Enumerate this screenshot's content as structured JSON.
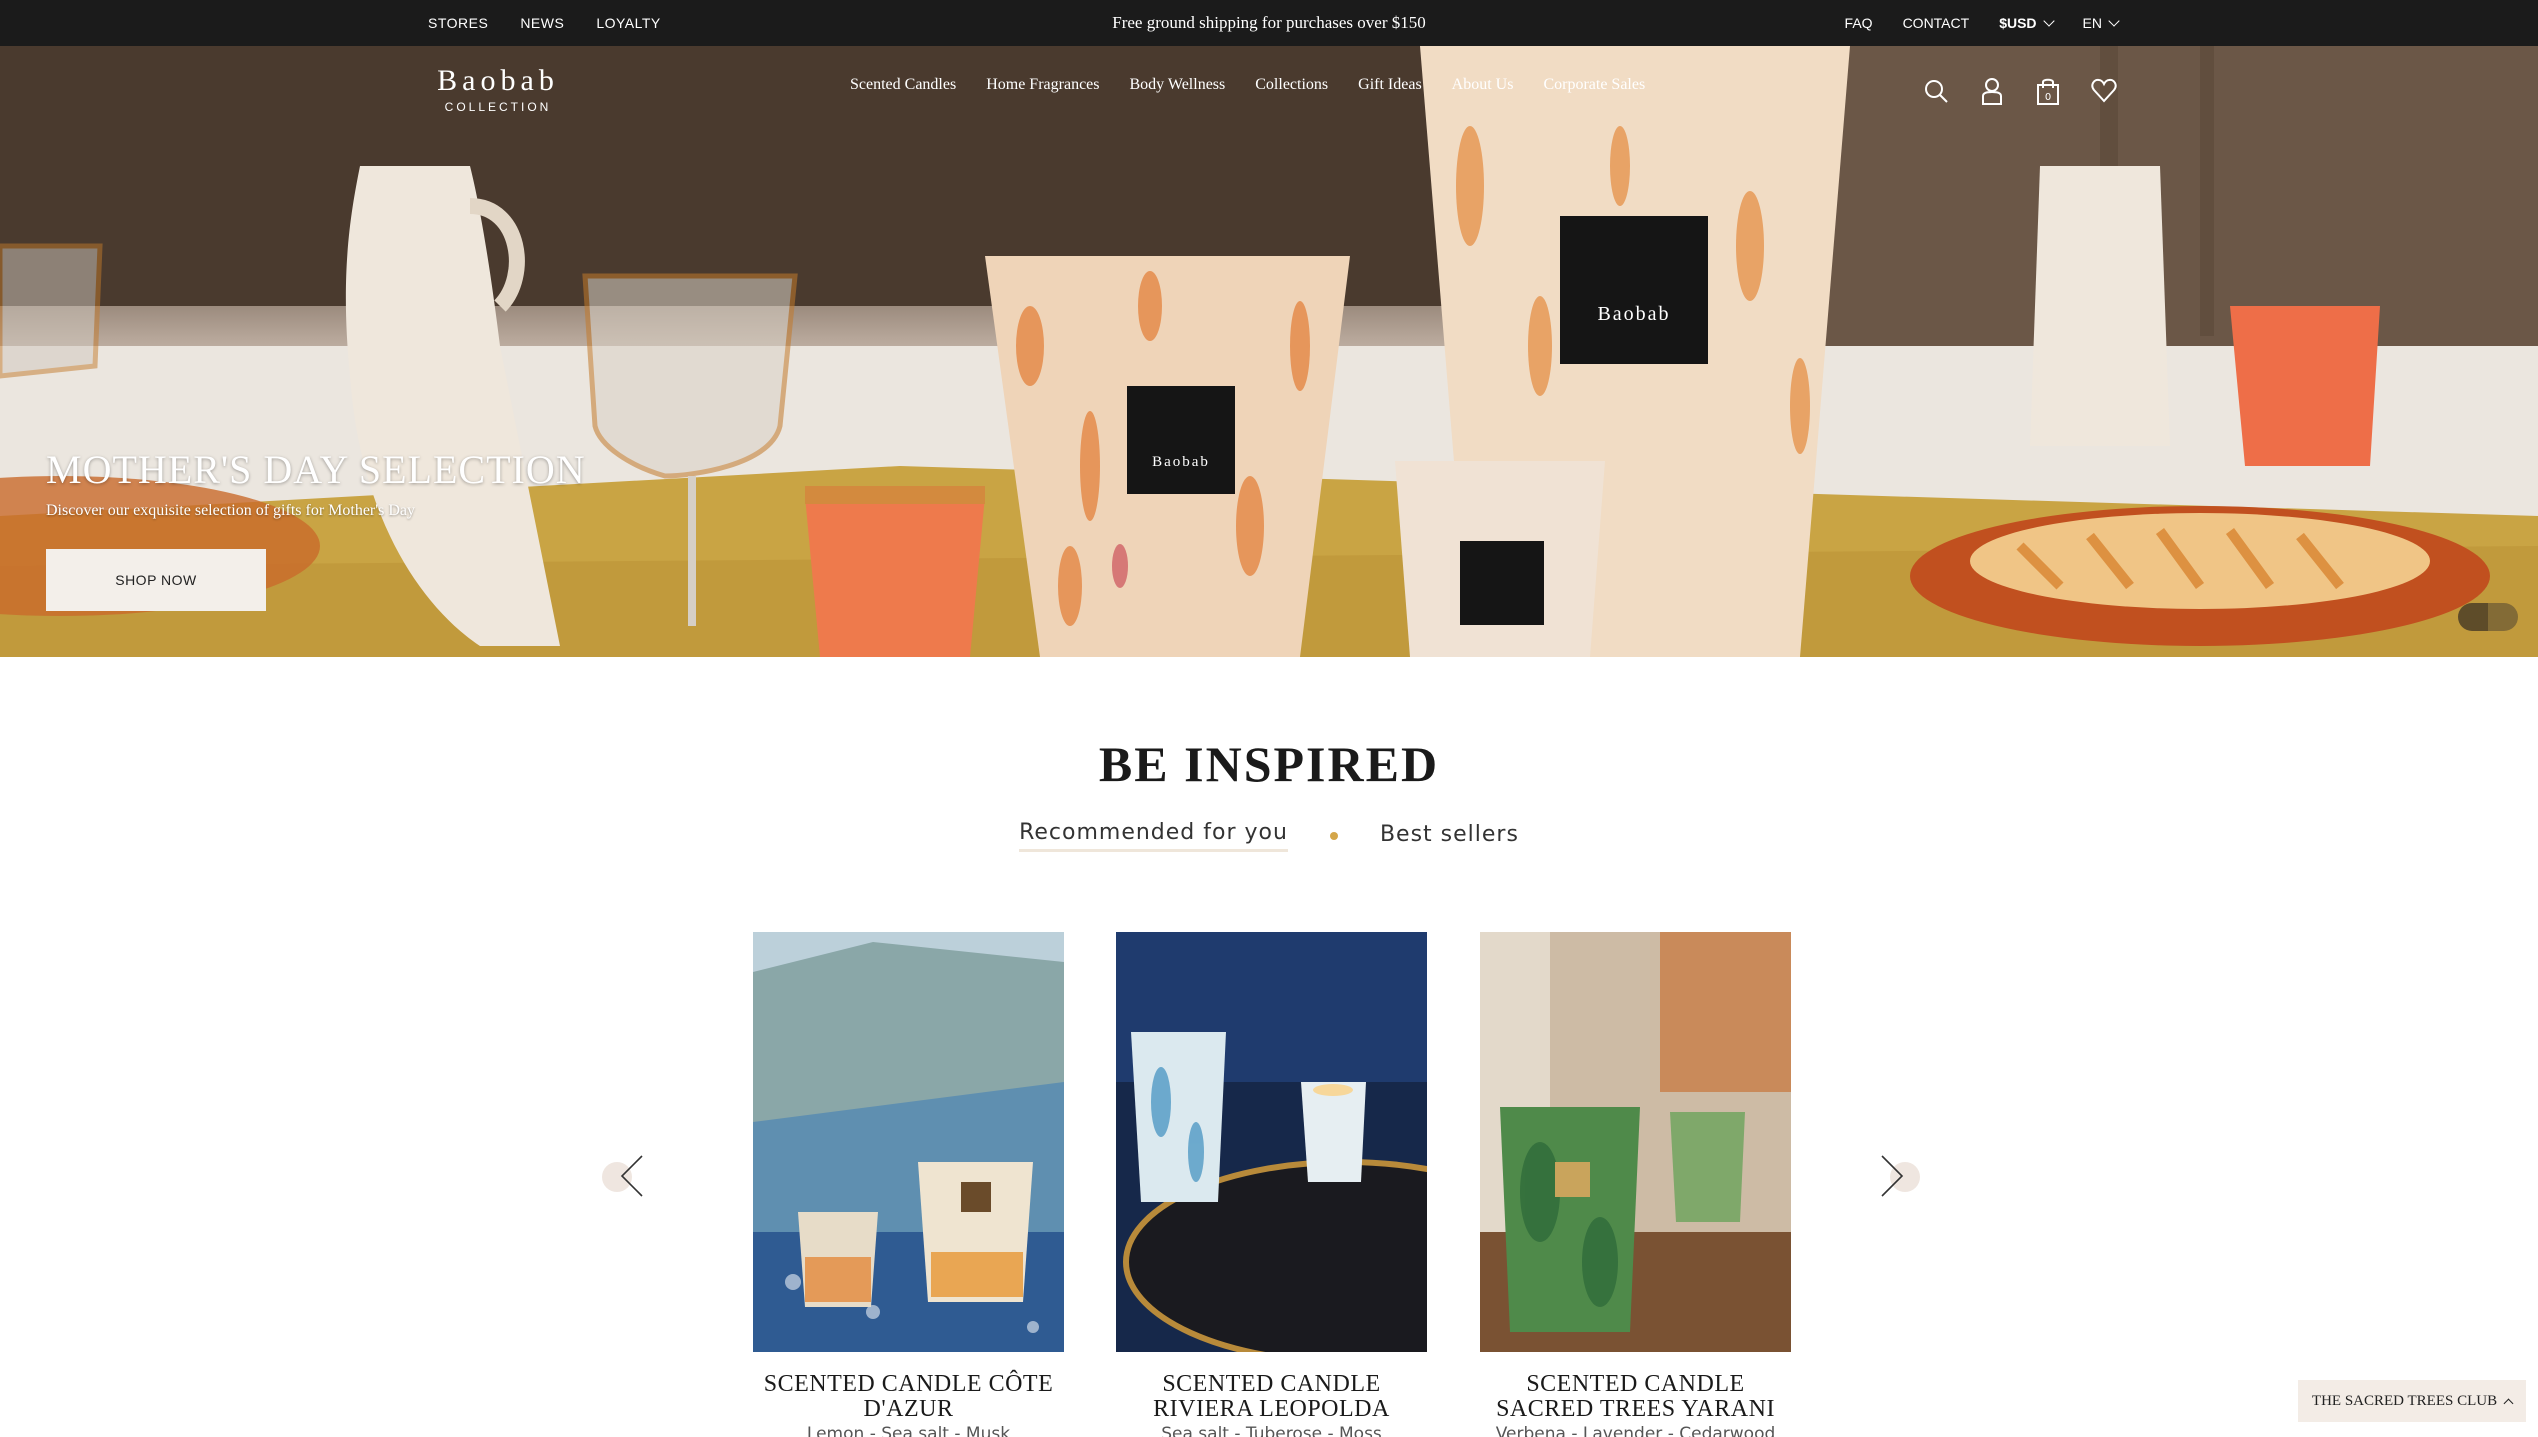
{
  "topbar": {
    "links_left": [
      "STORES",
      "NEWS",
      "LOYALTY"
    ],
    "promo": "Free ground shipping for purchases over $150",
    "faq": "FAQ",
    "contact": "CONTACT",
    "currency": "$USD",
    "language": "EN"
  },
  "header": {
    "logo_main": "Baobab",
    "logo_sub": "COLLECTION",
    "nav": [
      "Scented Candles",
      "Home Fragrances",
      "Body Wellness",
      "Collections",
      "Gift Ideas",
      "About Us",
      "Corporate Sales"
    ],
    "icons": [
      "search-icon",
      "user-icon",
      "bag-icon",
      "heart-icon"
    ]
  },
  "hero": {
    "title": "MOTHER'S DAY SELECTION",
    "subtitle": "Discover our exquisite selection of gifts for Mother's Day",
    "button": "SHOP NOW"
  },
  "inspired": {
    "title": "BE INSPIRED",
    "tabs": [
      "Recommended for you",
      "Best sellers"
    ],
    "active_tab": "Recommended for you"
  },
  "products": [
    {
      "name": "SCENTED CANDLE CÔTE D'AZUR",
      "notes": "Lemon - Sea salt - Musk"
    },
    {
      "name": "SCENTED CANDLE RIVIERA LEOPOLDA",
      "notes": "Sea salt - Tuberose - Moss"
    },
    {
      "name": "SCENTED CANDLE SACRED TREES YARANI",
      "notes": "Verbena - Lavender - Cedarwood"
    }
  ],
  "club_tab": "THE SACRED TREES CLUB",
  "colors": {
    "topbar_bg": "#1b1b1b",
    "accent_dot": "#d4a64a",
    "button_bg": "#f3efea"
  }
}
